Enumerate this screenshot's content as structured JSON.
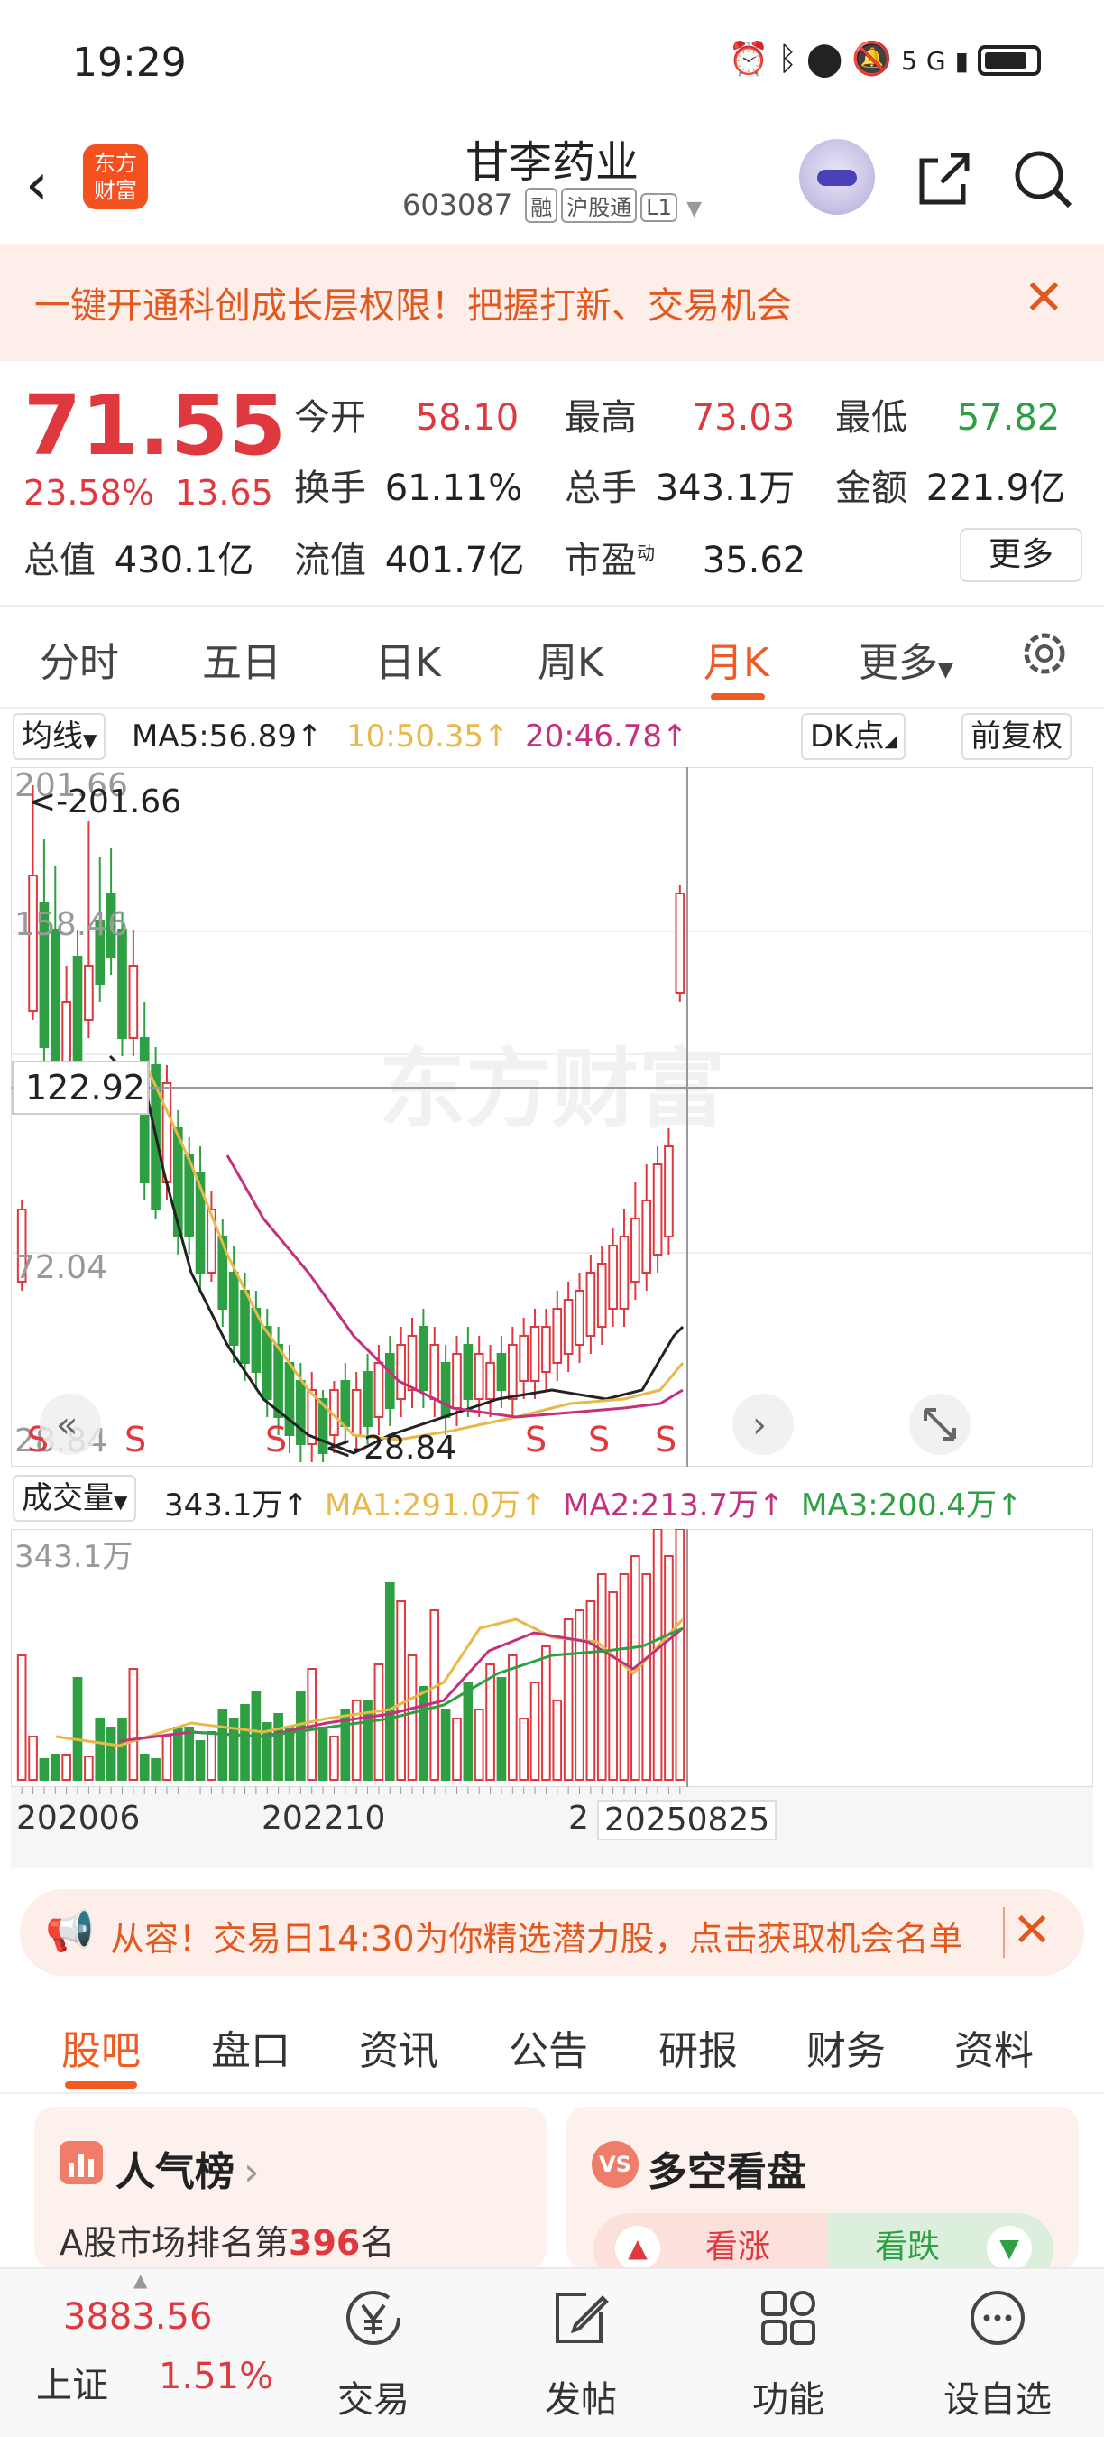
{
  "status": {
    "time": "19:29",
    "icons": [
      "alarm-icon",
      "bluetooth-icon",
      "location-icon",
      "mute-icon",
      "5g-icon",
      "signal-icon",
      "battery-icon"
    ]
  },
  "header": {
    "logo": "东方财富",
    "name": "甘李药业",
    "code": "603087",
    "tags": [
      "融",
      "沪股通",
      "L1"
    ]
  },
  "promo": {
    "text": "一键开通科创成长层权限！把握打新、交易机会"
  },
  "quote": {
    "price": "71.55",
    "change_pct": "23.58%",
    "change": "13.65",
    "fields": [
      {
        "label": "今开",
        "value": "58.10",
        "color": "red"
      },
      {
        "label": "最高",
        "value": "73.03",
        "color": "red"
      },
      {
        "label": "最低",
        "value": "57.82",
        "color": "green"
      },
      {
        "label": "换手",
        "value": "61.11%",
        "color": "black"
      },
      {
        "label": "总手",
        "value": "343.1万",
        "color": "black"
      },
      {
        "label": "金额",
        "value": "221.9亿",
        "color": "black"
      },
      {
        "label": "总值",
        "value": "430.1亿",
        "color": "black"
      },
      {
        "label": "流值",
        "value": "401.7亿",
        "color": "black"
      },
      {
        "label": "市盈",
        "value": "35.62",
        "color": "black",
        "sup": "动"
      }
    ],
    "more": "更多"
  },
  "period_tabs": [
    "分时",
    "五日",
    "日K",
    "周K",
    "月K",
    "更多"
  ],
  "active_period": "月K",
  "ma": {
    "selector": "均线",
    "ma5": "MA5:56.89↑",
    "ma10": "10:50.35↑",
    "ma20": "20:46.78↑",
    "dk": "DK点",
    "adjust": "前复权"
  },
  "kline": {
    "y_labels": [
      "201.66",
      "158.46",
      "122.92",
      "72.04",
      "28.84"
    ],
    "max_marker": "<-201.66",
    "min_marker": "<-28.84",
    "crosshair_value": "122.92",
    "signals": [
      "S",
      "S",
      "S",
      "S",
      "S",
      "S",
      "S"
    ],
    "watermark": "东方财富"
  },
  "volume": {
    "selector": "成交量",
    "value": "343.1万↑",
    "ma1": "MA1:291.0万↑",
    "ma2": "MA2:213.7万↑",
    "ma3": "MA3:200.4万↑",
    "y_label": "343.1万"
  },
  "dates": [
    "202006",
    "202210",
    "2",
    "20250825"
  ],
  "ad": {
    "text": "从容！交易日14:30为你精选潜力股，点击获取机会名单"
  },
  "content_tabs": [
    "股吧",
    "盘口",
    "资讯",
    "公告",
    "研报",
    "财务",
    "资料"
  ],
  "cards": {
    "popularity": {
      "title": "人气榜",
      "rank_prefix": "A股市场排名第",
      "rank": "396",
      "rank_suffix": "名"
    },
    "sentiment": {
      "title": "多空看盘",
      "up": "看涨",
      "down": "看跌"
    }
  },
  "bottom_nav": {
    "index_value": "3883.56",
    "index_name": "上证",
    "index_pct": "1.51%",
    "items": [
      "交易",
      "发帖",
      "功能",
      "设自选"
    ]
  },
  "colors": {
    "up": "#e0383f",
    "down": "#2ea043",
    "accent": "#f15a22",
    "ma5": "#222222",
    "ma10": "#e8b94a",
    "ma20": "#c4307d"
  }
}
